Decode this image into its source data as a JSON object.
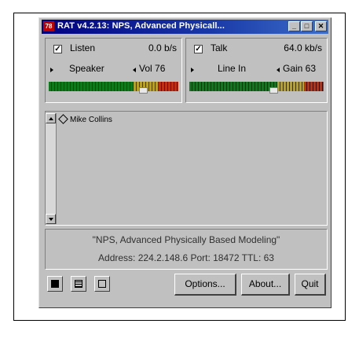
{
  "window": {
    "title": "RAT v4.2.13: NPS, Advanced Physicall...",
    "app_icon": "78"
  },
  "listen": {
    "label": "Listen",
    "checked": "✓",
    "rate": "0.0 b/s",
    "device": "Speaker",
    "volume_label": "Vol 76"
  },
  "talk": {
    "label": "Talk",
    "checked": "✓",
    "rate": "64.0 kb/s",
    "device": "Line In",
    "gain_label": "Gain 63"
  },
  "participants": [
    {
      "name": "Mike Collins"
    }
  ],
  "session": {
    "name": "\"NPS, Advanced Physically Based Modeling\"",
    "address_line": "Address: 224.2.148.6 Port: 18472 TTL: 63"
  },
  "buttons": {
    "options": "Options...",
    "about": "About...",
    "quit": "Quit"
  }
}
